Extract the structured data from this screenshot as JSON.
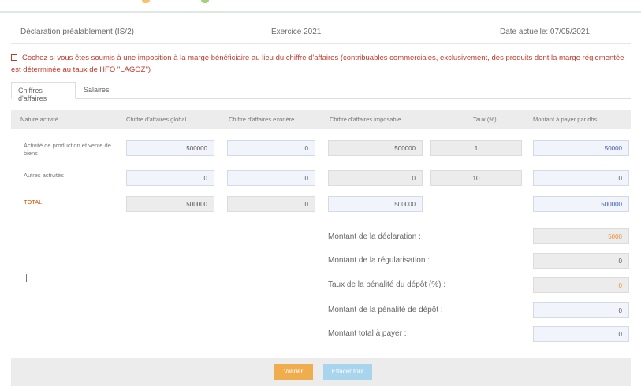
{
  "header": {
    "title": "Déclaration préalablement (IS/2)",
    "exercise": "Exercice 2021",
    "date": "Date actuelle: 07/05/2021"
  },
  "warning": {
    "text": "Cochez si vous êtes soumis à une imposition à la marge bénéficiaire au lieu du chiffre d'affaires (contribuables commerciales, exclusivement, des produits dont la marge réglementée est déterminée au taux de l'IFO \"LAGOZ\")"
  },
  "tabs": [
    {
      "label": "Chiffres d'affaires"
    },
    {
      "label": "Salaires"
    }
  ],
  "table": {
    "headers": [
      "Nature activité",
      "Chiffre d'affaires global",
      "Chiffre d'affaires exonéré",
      "Chiffre d'affaires imposable",
      "Taux (%)",
      "Montant à payer par dhs"
    ],
    "rows": [
      {
        "label": "Activité de production et vente de biens",
        "values": [
          "500000",
          "0",
          "500000",
          "1",
          "50000"
        ]
      },
      {
        "label": "Autres activités",
        "values": [
          "0",
          "0",
          "0",
          "10",
          "0"
        ]
      },
      {
        "label": "TOTAL",
        "values": [
          "500000",
          "0",
          "500000",
          "",
          "500000"
        ]
      }
    ]
  },
  "summary": [
    {
      "label": "Montant de la déclaration :",
      "value": "5000"
    },
    {
      "label": "Montant de la régularisation :",
      "value": "0"
    },
    {
      "label": "Taux de la pénalité du dépôt (%) :",
      "value": "0"
    },
    {
      "label": "Montant de la pénalité de dépôt :",
      "value": "0"
    },
    {
      "label": "Montant total à payer :",
      "value": "0"
    }
  ],
  "buttons": {
    "submit": "Valider",
    "cancel": "Effacer tout"
  },
  "colors": {
    "warning": "#c0392b",
    "input_blue": "#f2f4fc",
    "input_grey": "#ececec",
    "button_orange": "#f0ad4e",
    "button_lightblue": "#a9d4ee"
  }
}
